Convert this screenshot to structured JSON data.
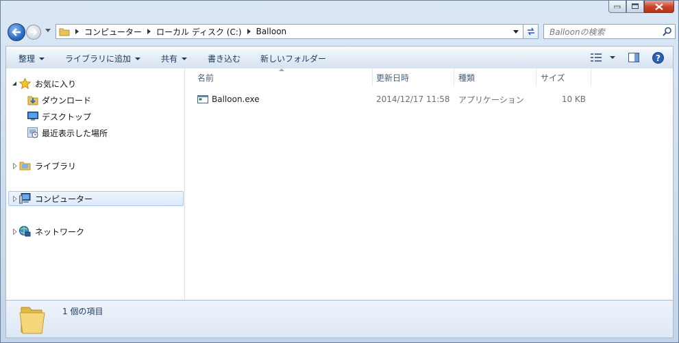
{
  "window": {
    "caption_buttons": [
      "minimize",
      "maximize",
      "close"
    ]
  },
  "address_bar": {
    "breadcrumbs": [
      "コンピューター",
      "ローカル ディスク (C:)",
      "Balloon"
    ]
  },
  "search": {
    "placeholder": "Balloonの検索"
  },
  "toolbar": {
    "organize": "整理",
    "add_to_library": "ライブラリに追加",
    "share": "共有",
    "burn": "書き込む",
    "new_folder": "新しいフォルダー"
  },
  "nav_pane": {
    "favorites": "お気に入り",
    "favorites_items": [
      "ダウンロード",
      "デスクトップ",
      "最近表示した場所"
    ],
    "libraries": "ライブラリ",
    "computer": "コンピューター",
    "network": "ネットワーク"
  },
  "columns": {
    "name": "名前",
    "date": "更新日時",
    "type": "種類",
    "size": "サイズ"
  },
  "files": [
    {
      "name": "Balloon.exe",
      "date": "2014/12/17 11:58",
      "type": "アプリケーション",
      "size": "10 KB"
    }
  ],
  "status_bar": {
    "item_count": "1 個の項目"
  },
  "colors": {
    "frame": "#c3d5ea",
    "toolbar_text": "#1e395b",
    "selection_border": "#a6c7ee",
    "close_button": "#c9462c"
  },
  "icons": [
    "back-arrow-icon",
    "forward-arrow-icon",
    "folder-icon",
    "refresh-icon",
    "search-icon",
    "view-options-icon",
    "preview-pane-icon",
    "help-icon",
    "star-icon",
    "download-icon",
    "desktop-icon",
    "recent-places-icon",
    "library-icon",
    "computer-icon",
    "network-icon",
    "exe-file-icon"
  ]
}
